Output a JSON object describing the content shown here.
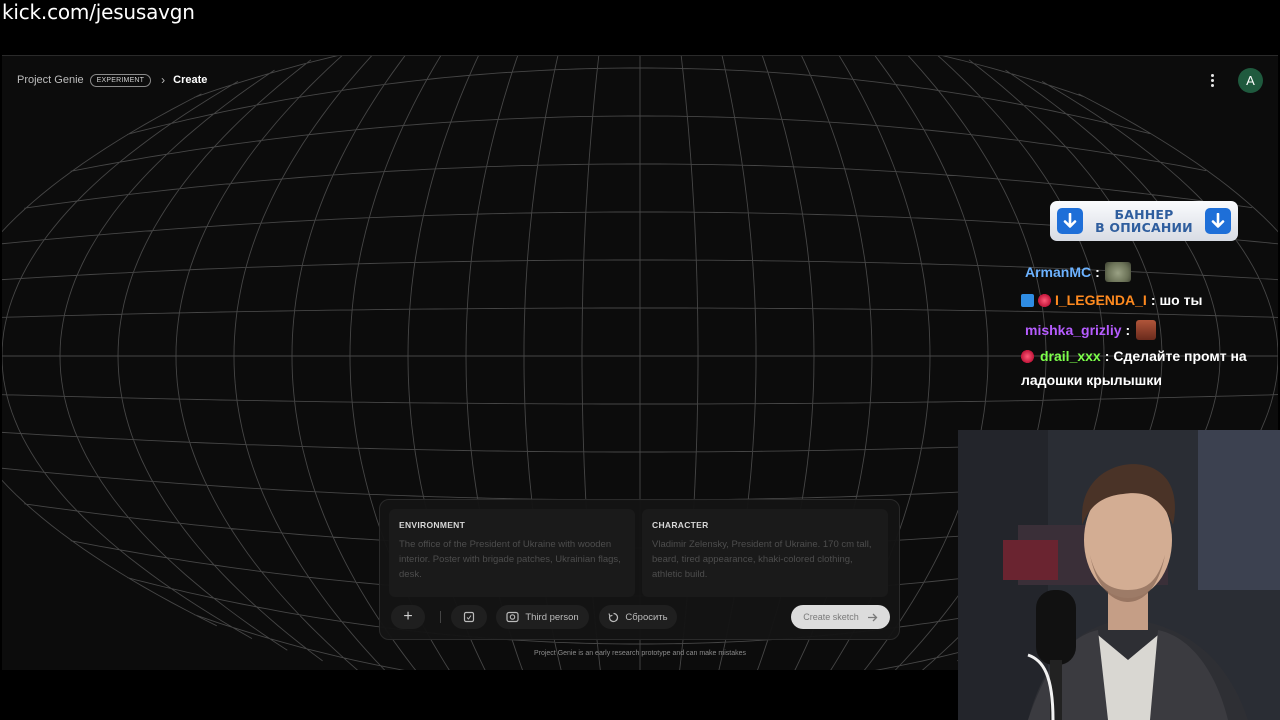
{
  "stream_url": "kick.com/jesusavgn",
  "app": {
    "name": "Project Genie",
    "badge": "EXPERIMENT",
    "breadcrumb_current": "Create",
    "avatar_letter": "A",
    "menu_icon": "more-vert-icon"
  },
  "prompt": {
    "environment": {
      "label": "ENVIRONMENT",
      "text": "The office of the President of Ukraine with wooden interior. Poster with brigade patches, Ukrainian flags, desk."
    },
    "character": {
      "label": "CHARACTER",
      "text": "Vladimir Zelensky, President of Ukraine. 170 cm tall, beard, tired appearance, khaki-colored clothing, athletic build."
    },
    "toolbar": {
      "add_icon": "plus-icon",
      "frame_icon": "frame-icon",
      "camera_label": "Third person",
      "camera_icon": "camera-view-icon",
      "reset_label": "Сбросить",
      "reset_icon": "reset-icon",
      "create_label": "Create sketch",
      "create_icon": "arrow-right-icon"
    }
  },
  "disclaimer": "Project Genie is an early research prototype and can make mistakes",
  "banner": {
    "line1": "БАННЕР",
    "line2": "В ОПИСАНИИ",
    "icon": "arrow-down-icon"
  },
  "chat": [
    {
      "user": "ArmanMC",
      "separator": ":",
      "text": "",
      "user_color": "#6cb2ff",
      "emote": "frog-emote"
    },
    {
      "user": "I_LEGENDA_I",
      "separator": ":",
      "text": "шо ты",
      "user_color": "#ff8a1f",
      "badges": [
        "boost-badge",
        "lips-badge"
      ]
    },
    {
      "user": "mishka_grizliy",
      "separator": ":",
      "text": "",
      "user_color": "#b65cff",
      "emote": "face-emote"
    },
    {
      "user": "drail_xxx",
      "separator": ":",
      "text": "Сделайте промт на",
      "text_line2": "ладошки крылышки",
      "user_color": "#7cff4a",
      "badges": [
        "lips-badge"
      ]
    }
  ],
  "colors": {
    "background": "#0c0c0c",
    "grid": "#5a5a5a",
    "avatar": "#1f5a3e",
    "banner_accent": "#1e6fd8"
  }
}
